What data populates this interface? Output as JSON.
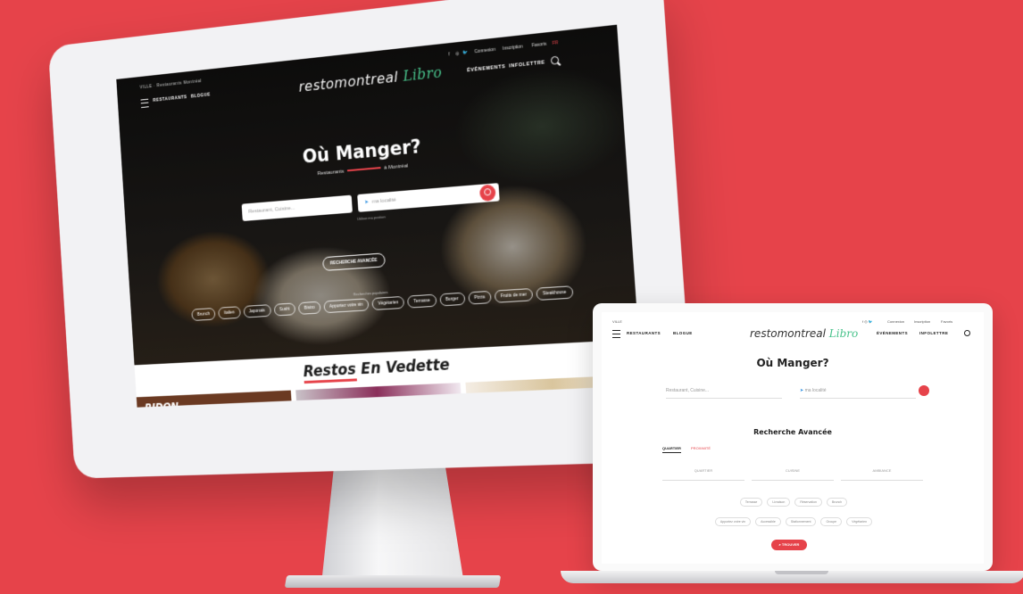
{
  "colors": {
    "background": "#e6434a",
    "accent": "#e6434a",
    "libro_green": "#48c28b"
  },
  "desktop": {
    "breadcrumb": "VILLE · Restaurants Montréal",
    "nav_left": [
      "RESTAURANTS",
      "BLOGUE"
    ],
    "logo_main": "restomontreal",
    "logo_libro": "Libro",
    "utility": [
      "f",
      "◎",
      "🐦",
      "Connexion",
      "Inscription",
      "Favoris",
      "FR"
    ],
    "nav_right": [
      "ÉVÉNEMENTS",
      "INFOLETTRE"
    ],
    "hero_title": "Où Manger?",
    "hero_sub_left": "Restaurants",
    "hero_sub_right": "à Montréal",
    "search_placeholder": "Restaurant, Cuisine...",
    "location_placeholder": "ma localité",
    "location_hint": "Utiliser ma position",
    "advanced_button": "RECHERCHE AVANCÉE",
    "popular_label": "Recherches populaires",
    "pills": [
      "Brunch",
      "Italien",
      "Japonais",
      "Sushi",
      "Bistro",
      "Apportez votre vin",
      "Végétarien",
      "Terrasse",
      "Burger",
      "Pizza",
      "Fruits de mer",
      "Steakhouse"
    ],
    "featured_title_hl": "Restos",
    "featured_title_rest": "En Vedette",
    "thumb_text": "RIDON"
  },
  "laptop": {
    "breadcrumb": "VILLE",
    "nav_left": [
      "RESTAURANTS",
      "BLOGUE"
    ],
    "logo_main": "restomontreal",
    "logo_libro": "Libro",
    "utility": [
      "f ◎ 🐦",
      "Connexion",
      "Inscription",
      "Favoris"
    ],
    "nav_right": [
      "ÉVÉNEMENTS",
      "INFOLETTRE"
    ],
    "hero_title": "Où Manger?",
    "search_placeholder": "Restaurant, Cuisine...",
    "location_placeholder": "ma localité",
    "adv_title": "Recherche Avancée",
    "tab_active": "QUARTIER",
    "tab_other": "PROXIMITÉ",
    "selects": [
      "QUARTIER",
      "CUISINE",
      "AMBIANCE"
    ],
    "pills_row1": [
      "Terrasse",
      "Livraison",
      "Réservation",
      "Brunch"
    ],
    "pills_row2": [
      "Apportez votre vin",
      "Accessible",
      "Stationnement",
      "Groupe",
      "Végétarien"
    ],
    "find_button": "⌕ TROUVER"
  }
}
